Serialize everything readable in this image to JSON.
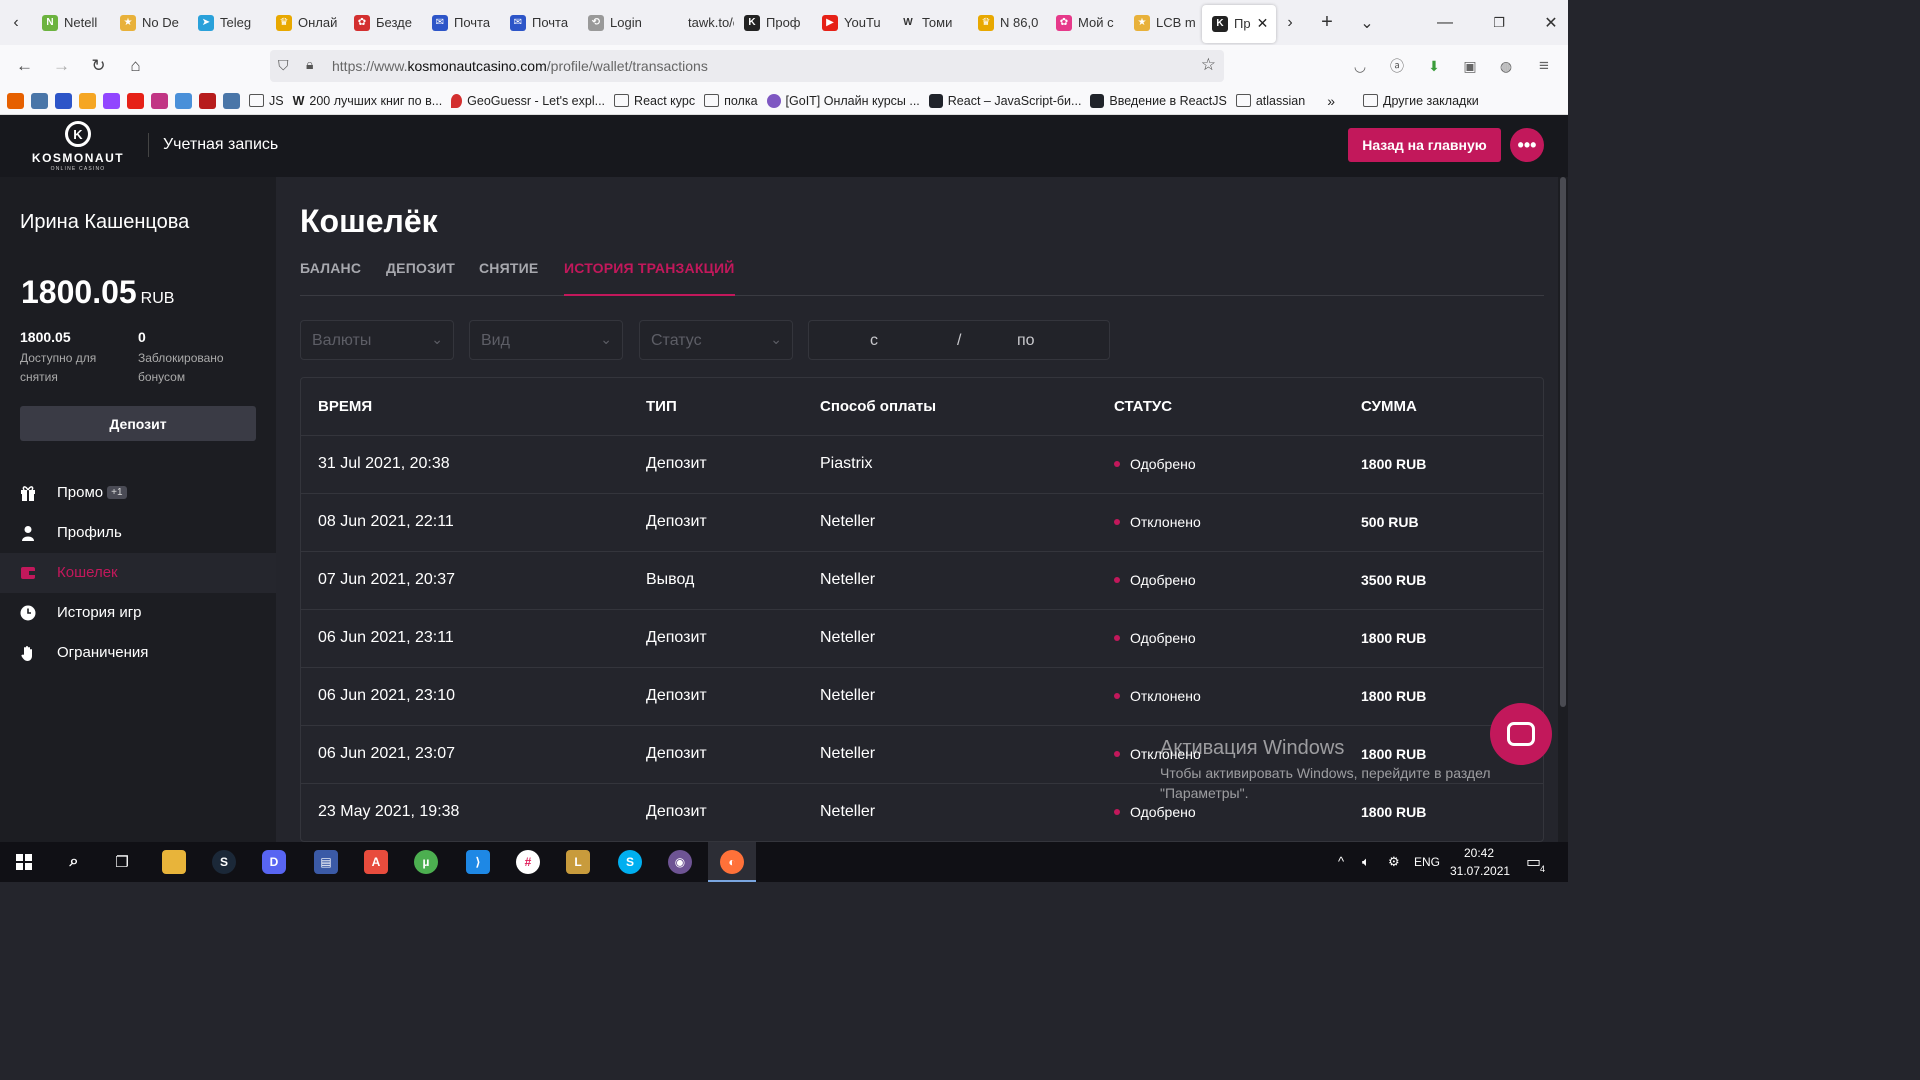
{
  "browser": {
    "tabs": [
      {
        "label": "Netell",
        "color": "#6cb33f",
        "glyph": "N"
      },
      {
        "label": "No De",
        "color": "#e8b13a",
        "glyph": "★"
      },
      {
        "label": "Teleg",
        "color": "#2aa1da",
        "glyph": "➤"
      },
      {
        "label": "Онлай",
        "color": "#e8a800",
        "glyph": "♛"
      },
      {
        "label": "Безде",
        "color": "#d32f2f",
        "glyph": "✿"
      },
      {
        "label": "Почта",
        "color": "#2d55c8",
        "glyph": "✉"
      },
      {
        "label": "Почта",
        "color": "#2d55c8",
        "glyph": "✉"
      },
      {
        "label": "Login",
        "color": "#999999",
        "glyph": "⟲"
      },
      {
        "label": "tawk.to/ch",
        "color": "#f0f0f4",
        "glyph": ""
      },
      {
        "label": "Проф",
        "color": "#222222",
        "glyph": "K"
      },
      {
        "label": "YouTu",
        "color": "#e62117",
        "glyph": "▶"
      },
      {
        "label": "Томи",
        "color": "#f0f0f4",
        "glyph": "W"
      },
      {
        "label": "N 86,0",
        "color": "#e8a800",
        "glyph": "♛"
      },
      {
        "label": "Мой с",
        "color": "#e6398a",
        "glyph": "✿"
      },
      {
        "label": "LCB m",
        "color": "#e8b13a",
        "glyph": "★"
      }
    ],
    "active_tab": {
      "label": "Пр",
      "color": "#222222",
      "glyph": "K"
    },
    "url_prefix": "https://www.",
    "url_domain": "kosmonautcasino.com",
    "url_path": "/profile/wallet/transactions",
    "bookmark_icons": [
      "#e66000",
      "#4a76a8",
      "#2d55c8",
      "#f5a623",
      "#9146ff",
      "#e62117",
      "#c13584",
      "#4a90d9",
      "#b71c1c",
      "#4a76a8"
    ],
    "bookmarks": [
      {
        "label": "JS",
        "icon": "folder"
      },
      {
        "label": "200 лучших книг по в...",
        "icon": "wiki"
      },
      {
        "label": "GeoGuessr - Let's expl...",
        "icon": "pin"
      },
      {
        "label": "React курс",
        "icon": "folder"
      },
      {
        "label": "полка",
        "icon": "folder"
      },
      {
        "label": "[GoIT] Онлайн курсы ...",
        "icon": "goit"
      },
      {
        "label": "React – JavaScript-би...",
        "icon": "react"
      },
      {
        "label": "Введение в ReactJS",
        "icon": "react"
      },
      {
        "label": "atlassian",
        "icon": "folder"
      },
      {
        "label": "Другие закладки",
        "icon": "folder"
      }
    ]
  },
  "header": {
    "logo_brand": "KOSMONAUT",
    "logo_sub": "ONLINE CASINO",
    "section_title": "Учетная запись",
    "back_button": "Назад на главную"
  },
  "sidebar": {
    "user_name": "Ирина Кашенцова",
    "balance": "1800.05",
    "currency": "RUB",
    "available_value": "1800.05",
    "available_label": "Доступно для снятия",
    "blocked_value": "0",
    "blocked_label": "Заблокировано бонусом",
    "deposit_button": "Депозит",
    "menu": [
      {
        "label": "Промо",
        "icon": "gift-icon",
        "badge": "+1"
      },
      {
        "label": "Профиль",
        "icon": "user-icon"
      },
      {
        "label": "Кошелек",
        "icon": "wallet-icon",
        "active": true
      },
      {
        "label": "История игр",
        "icon": "clock-icon"
      },
      {
        "label": "Ограничения",
        "icon": "hand-icon"
      }
    ]
  },
  "wallet": {
    "title": "Кошелёк",
    "tabs": [
      "БАЛАНС",
      "ДЕПОЗИТ",
      "СНЯТИЕ",
      "ИСТОРИЯ ТРАНЗАКЦИЙ"
    ],
    "active_tab_index": 3,
    "filters": {
      "currency_placeholder": "Валюты",
      "type_placeholder": "Вид",
      "status_placeholder": "Статус",
      "date_from": "с",
      "date_sep": "/",
      "date_to": "по"
    },
    "columns": [
      "ВРЕМЯ",
      "ТИП",
      "Способ оплаты",
      "СТАТУС",
      "СУММА"
    ],
    "rows": [
      {
        "time": "31 Jul 2021, 20:38",
        "type": "Депозит",
        "method": "Piastrix",
        "status": "Одобрено",
        "amount": "1800 RUB"
      },
      {
        "time": "08 Jun 2021, 22:11",
        "type": "Депозит",
        "method": "Neteller",
        "status": "Отклонено",
        "amount": "500 RUB"
      },
      {
        "time": "07 Jun 2021, 20:37",
        "type": "Вывод",
        "method": "Neteller",
        "status": "Одобрено",
        "amount": "3500 RUB"
      },
      {
        "time": "06 Jun 2021, 23:11",
        "type": "Депозит",
        "method": "Neteller",
        "status": "Одобрено",
        "amount": "1800 RUB"
      },
      {
        "time": "06 Jun 2021, 23:10",
        "type": "Депозит",
        "method": "Neteller",
        "status": "Отклонено",
        "amount": "1800 RUB"
      },
      {
        "time": "06 Jun 2021, 23:07",
        "type": "Депозит",
        "method": "Neteller",
        "status": "Отклонено",
        "amount": "1800 RUB"
      },
      {
        "time": "23 May 2021, 19:38",
        "type": "Депозит",
        "method": "Neteller",
        "status": "Одобрено",
        "amount": "1800 RUB"
      }
    ]
  },
  "watermark": {
    "title": "Активация Windows",
    "text": "Чтобы активировать Windows, перейдите в раздел \"Параметры\"."
  },
  "taskbar": {
    "lang": "ENG",
    "time": "20:42",
    "date": "31.07.2021",
    "notif_count": "4"
  },
  "colors": {
    "accent": "#c2185b",
    "bg": "#24252c",
    "sidebar": "#1c1d22",
    "header": "#17181d"
  }
}
